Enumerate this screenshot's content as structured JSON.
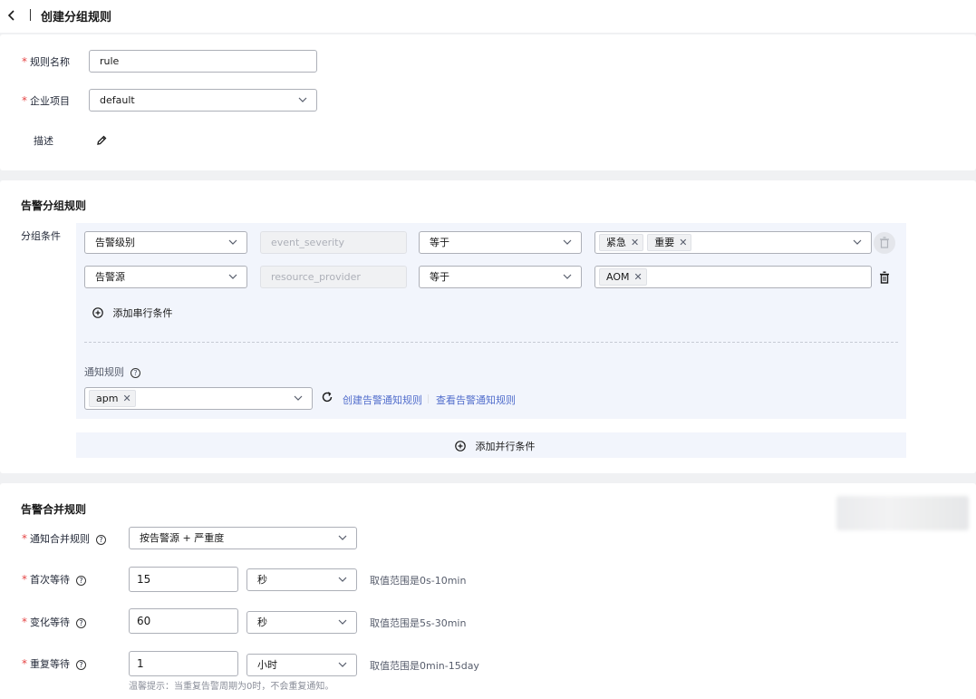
{
  "header": {
    "title": "创建分组规则"
  },
  "basic": {
    "rule_name_label": "规则名称",
    "rule_name_value": "rule",
    "enterprise_label": "企业项目",
    "enterprise_value": "default",
    "desc_label": "描述"
  },
  "grouping": {
    "section_title": "告警分组规则",
    "condition_label": "分组条件",
    "rows": [
      {
        "field": "告警级别",
        "key": "event_severity",
        "operator": "等于",
        "values": [
          "紧急",
          "重要"
        ]
      },
      {
        "field": "告警源",
        "key": "resource_provider",
        "operator": "等于",
        "values": [
          "AOM"
        ]
      }
    ],
    "add_serial_label": "添加串行条件",
    "notify_rule_label": "通知规则",
    "notify_rule_values": [
      "apm"
    ],
    "create_link": "创建告警通知规则",
    "view_link": "查看告警通知规则",
    "add_parallel_label": "添加并行条件"
  },
  "merge": {
    "section_title": "告警合并规则",
    "merge_rule_label": "通知合并规则",
    "merge_rule_value": "按告警源 + 严重度",
    "first_wait_label": "首次等待",
    "first_wait_value": "15",
    "first_wait_unit": "秒",
    "first_wait_hint": "取值范围是0s-10min",
    "change_wait_label": "变化等待",
    "change_wait_value": "60",
    "change_wait_unit": "秒",
    "change_wait_hint": "取值范围是5s-30min",
    "repeat_wait_label": "重复等待",
    "repeat_wait_value": "1",
    "repeat_wait_unit": "小时",
    "repeat_wait_hint": "取值范围是0min-15day",
    "repeat_tip": "温馨提示：当重复告警周期为0时，不会重复通知。"
  },
  "colors": {
    "required": "#e54545",
    "link": "#526ecc",
    "panel_bg": "#f2f5fc"
  }
}
